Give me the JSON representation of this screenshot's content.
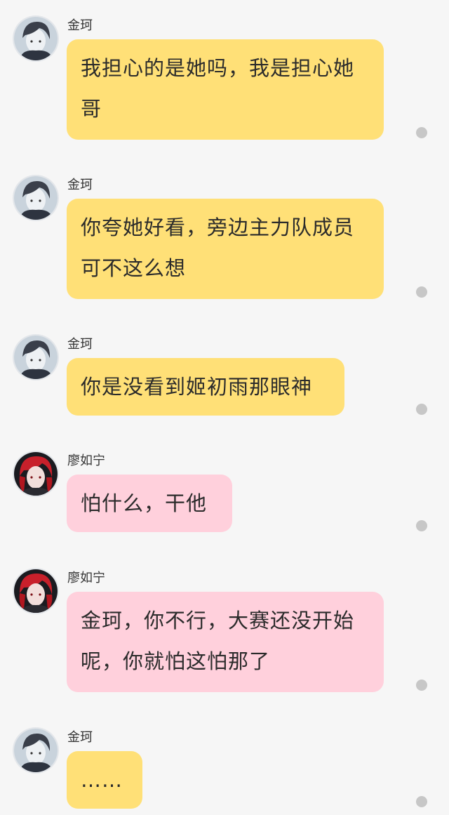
{
  "messages": [
    {
      "sender": "金珂",
      "avatar": "male-portrait-avatar",
      "text": "我担心的是她吗，我是担心她哥",
      "bubble_color": "#ffe077"
    },
    {
      "sender": "金珂",
      "avatar": "male-portrait-avatar",
      "text": "你夸她好看，旁边主力队成员可不这么想",
      "bubble_color": "#ffe077"
    },
    {
      "sender": "金珂",
      "avatar": "male-portrait-avatar",
      "text": "你是没看到姬初雨那眼神",
      "bubble_color": "#ffe077"
    },
    {
      "sender": "廖如宁",
      "avatar": "red-hair-portrait-avatar",
      "text": "怕什么，干他",
      "bubble_color": "#ffd0dc"
    },
    {
      "sender": "廖如宁",
      "avatar": "red-hair-portrait-avatar",
      "text": "金珂，你不行，大赛还没开始呢，你就怕这怕那了",
      "bubble_color": "#ffd0dc"
    },
    {
      "sender": "金珂",
      "avatar": "male-portrait-avatar",
      "text": "……",
      "bubble_color": "#ffe077"
    }
  ]
}
